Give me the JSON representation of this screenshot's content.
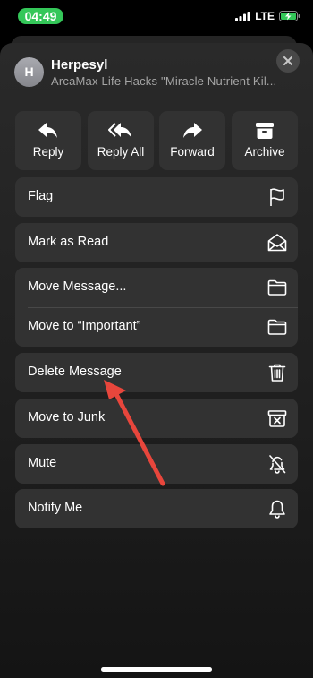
{
  "status_bar": {
    "time": "04:49",
    "network": "LTE"
  },
  "email": {
    "avatar_initial": "H",
    "sender": "Herpesyl",
    "subject": "ArcaMax Life Hacks \"Miracle Nutrient Kil..."
  },
  "quick_actions": [
    {
      "label": "Reply",
      "icon": "reply-icon"
    },
    {
      "label": "Reply All",
      "icon": "reply-all-icon"
    },
    {
      "label": "Forward",
      "icon": "forward-icon"
    },
    {
      "label": "Archive",
      "icon": "archive-icon"
    }
  ],
  "menu": {
    "flag": {
      "label": "Flag",
      "icon": "flag-icon"
    },
    "mark_read": {
      "label": "Mark as Read",
      "icon": "envelope-open-icon"
    },
    "move_message": {
      "label": "Move Message...",
      "icon": "folder-icon"
    },
    "move_important": {
      "label": "Move to “Important”",
      "icon": "folder-icon"
    },
    "delete": {
      "label": "Delete Message",
      "icon": "trash-icon"
    },
    "junk": {
      "label": "Move to Junk",
      "icon": "junk-bin-icon"
    },
    "mute": {
      "label": "Mute",
      "icon": "bell-slash-icon"
    },
    "notify": {
      "label": "Notify Me",
      "icon": "bell-icon"
    }
  },
  "colors": {
    "accent_green": "#34c759",
    "annotation_arrow": "#e8463c",
    "row_background": "#323232"
  }
}
